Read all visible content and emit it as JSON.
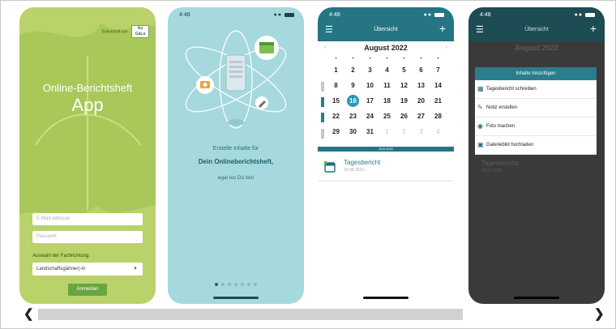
{
  "app1": {
    "status_time": "",
    "badge_text": "Entwickelt von",
    "badge_logo_line1": "Au",
    "badge_logo_line2": "GaLa",
    "title_line1": "Online-Berichtsheft",
    "title_line2": "App",
    "email_placeholder": "E-Mail-Adresse",
    "password_placeholder": "Passwort",
    "specialty_label": "Auswahl der Fachrichtung:",
    "specialty_value": "Landschaftsgärtner(-in",
    "login_button": "Anmelden"
  },
  "app2": {
    "status_time": "4:48",
    "line1": "Erstelle Inhalte für",
    "line2": "Dein Onlineberichtsheft,",
    "line3": "egal wo Du bist",
    "page_count": 7,
    "active_page": 0
  },
  "app3": {
    "status_time": "4:48",
    "nav_title": "Übersicht",
    "month_label": "August 2022",
    "weeks": [
      [
        "1",
        "2",
        "3",
        "4",
        "5",
        "6",
        "7"
      ],
      [
        "8",
        "9",
        "10",
        "11",
        "12",
        "13",
        "14"
      ],
      [
        "15",
        "16",
        "17",
        "18",
        "19",
        "20",
        "21"
      ],
      [
        "22",
        "23",
        "24",
        "25",
        "26",
        "27",
        "28"
      ],
      [
        "29",
        "30",
        "31",
        "1",
        "2",
        "3",
        "4"
      ]
    ],
    "today": "16",
    "selected_date": "16.8.2022",
    "entry_title": "Tagesbericht",
    "entry_date": "16.08.2022"
  },
  "app4": {
    "status_time": "4:48",
    "nav_title": "Übersicht",
    "month_label": "August 2022",
    "bg_entry_title": "Tagesbericht",
    "bg_entry_date": "16.08.2022",
    "sheet_title": "Inhalte hinzufügen",
    "sheet_items": [
      {
        "label": "Tagesbericht schreiben",
        "icon": "calendar-icon"
      },
      {
        "label": "Notiz erstellen",
        "icon": "pencil-icon"
      },
      {
        "label": "Foto machen",
        "icon": "camera-icon"
      },
      {
        "label": "Galeriebild hochladen",
        "icon": "image-icon"
      }
    ]
  },
  "colors": {
    "leaf_green": "#b9d36a",
    "mint": "#a5d9dd",
    "teal_nav": "#257585",
    "dark_overlay": "#3a3a3a"
  }
}
